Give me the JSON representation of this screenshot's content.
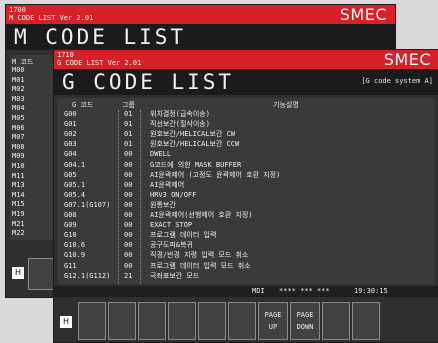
{
  "back": {
    "top_line1": "1700",
    "top_line2": "M CODE LIST Ver 2.01",
    "brand": "SMEC",
    "title": "M CODE LIST",
    "header_code": "M 코드",
    "codes": [
      "M00",
      "M01",
      "M02",
      "M03",
      "M04",
      "M05",
      "M06",
      "M07",
      "M08",
      "M09",
      "M10",
      "M11",
      "M13",
      "M14",
      "M15",
      "M19",
      "M21",
      "M22"
    ],
    "mode_label": "H"
  },
  "front": {
    "top_line1": "1710",
    "top_line2": "G CODE LIST Ver 2.01",
    "brand": "SMEC",
    "title": "G CODE LIST",
    "system_mode": "[G code system A]",
    "headers": {
      "code": "G 코드",
      "group": "그룹",
      "function": "기능설명"
    },
    "rows": [
      {
        "code": "G00",
        "group": "01",
        "desc": "위치결정(급속이송)"
      },
      {
        "code": "G01",
        "group": "01",
        "desc": "직선보간(절삭이송)"
      },
      {
        "code": "G02",
        "group": "01",
        "desc": "원호보간/HELICAL보간 CW"
      },
      {
        "code": "G03",
        "group": "01",
        "desc": "원호보간/HELICAL보간 CCW"
      },
      {
        "code": "G04",
        "group": "00",
        "desc": "DWELL"
      },
      {
        "code": "G04.1",
        "group": "00",
        "desc": "G코드에 의한 MASK BUFFER"
      },
      {
        "code": "G05",
        "group": "00",
        "desc": "AI윤곽제어 (고정도 윤곽제어 호환 지정)"
      },
      {
        "code": "G05.1",
        "group": "00",
        "desc": "AI윤곽제어"
      },
      {
        "code": "G05.4",
        "group": "00",
        "desc": "HRV3 ON/OFF"
      },
      {
        "code": "G07.1(G107)",
        "group": "00",
        "desc": "원통보간"
      },
      {
        "code": "G08",
        "group": "00",
        "desc": "AI윤곽제어(선행제어 호환 지정)"
      },
      {
        "code": "G09",
        "group": "00",
        "desc": "EXACT STOP"
      },
      {
        "code": "G10",
        "group": "00",
        "desc": "프로그램 데이터 입력"
      },
      {
        "code": "G10.6",
        "group": "00",
        "desc": "공구도피&복귀"
      },
      {
        "code": "G10.9",
        "group": "00",
        "desc": "직경/반경 지령 입력 모드 취소"
      },
      {
        "code": "G11",
        "group": "00",
        "desc": "프로그램 데이터 입력 모드 취소"
      },
      {
        "code": "G12.1(G112)",
        "group": "21",
        "desc": "극좌표보간 모드"
      }
    ],
    "status_mode": "MDI",
    "status_stars": "**** *** ***",
    "status_time": "19:30:15",
    "keys": [
      "PAGE UP",
      "PAGE DOWN"
    ],
    "key_page_up": [
      "PAGE",
      "UP"
    ],
    "key_page_down": [
      "PAGE",
      "DOWN"
    ],
    "mode_label": "H"
  }
}
